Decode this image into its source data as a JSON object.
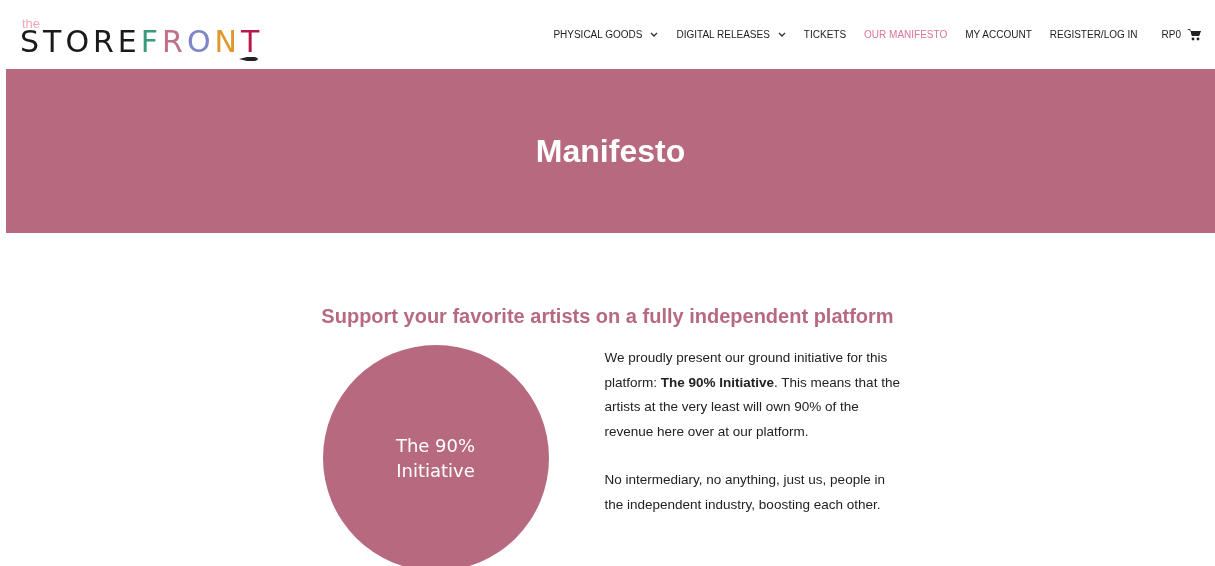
{
  "logo": {
    "prefix": "the",
    "letters": [
      {
        "char": "S",
        "color": "#1a1a1a"
      },
      {
        "char": "T",
        "color": "#1a1a1a"
      },
      {
        "char": "O",
        "color": "#1a1a1a"
      },
      {
        "char": "R",
        "color": "#1a1a1a"
      },
      {
        "char": "E",
        "color": "#1a1a1a"
      },
      {
        "char": "F",
        "color": "#3a9a7a"
      },
      {
        "char": "R",
        "color": "#c07088"
      },
      {
        "char": "O",
        "color": "#7f86c8"
      },
      {
        "char": "N",
        "color": "#e3962c"
      },
      {
        "char": "T",
        "color": "#b8194a"
      }
    ]
  },
  "nav": [
    {
      "label": "PHYSICAL GOODS",
      "dropdown": true,
      "selected": false
    },
    {
      "label": "DIGITAL RELEASES",
      "dropdown": true,
      "selected": false
    },
    {
      "label": "TICKETS",
      "dropdown": false,
      "selected": false
    },
    {
      "label": "OUR MANIFESTO",
      "dropdown": false,
      "selected": true
    },
    {
      "label": "MY ACCOUNT",
      "dropdown": false,
      "selected": false
    },
    {
      "label": "REGISTER/LOG IN",
      "dropdown": false,
      "selected": false
    }
  ],
  "cart": {
    "amount": "RP0"
  },
  "banner": {
    "title": "Manifesto"
  },
  "section": {
    "heading": "Support your favorite artists on a fully independent platform",
    "circle_text": "The 90% Initiative",
    "paragraphs": [
      "We proudly present our ground initiative for this platform: **The 90% Initiative**. This means that the artists at the very least will own 90% of the revenue here over at our platform.",
      "No intermediary, no anything, just us, people in the independent industry, boosting each other."
    ]
  }
}
